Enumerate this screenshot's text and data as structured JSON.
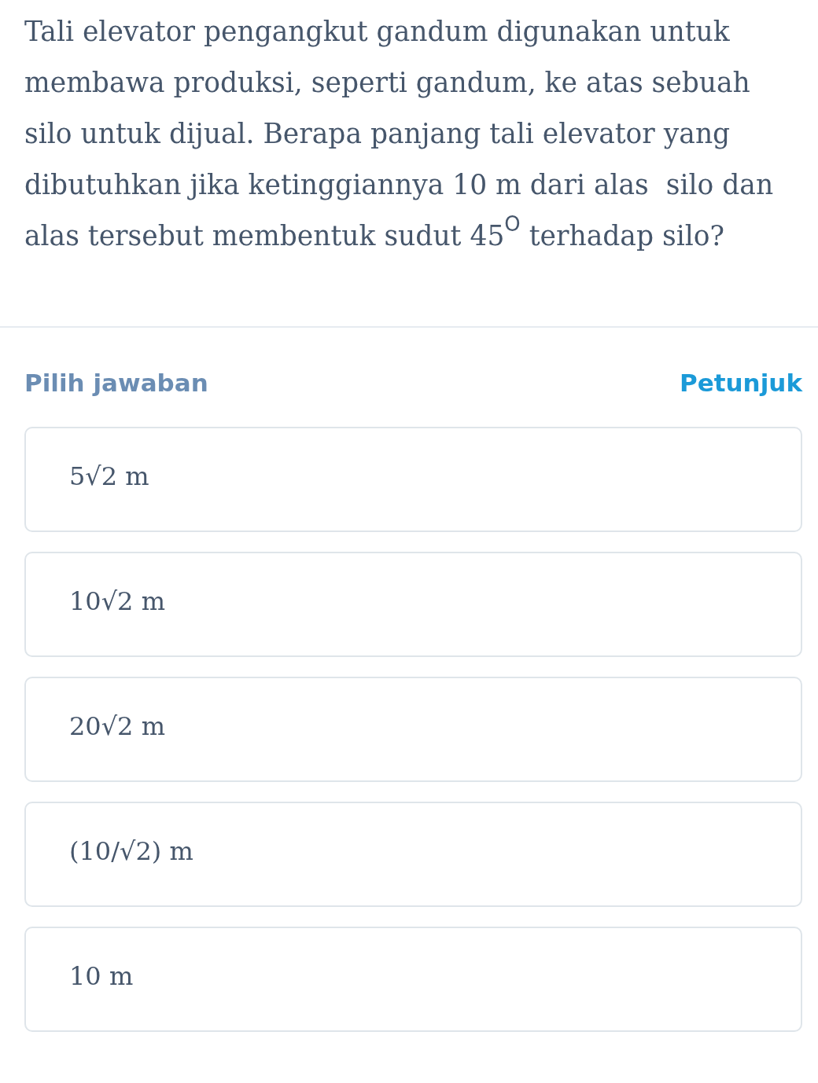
{
  "question": {
    "text": "Tali elevator pengangkut gandum digunakan untuk membawa produksi, seperti gandum, ke atas sebuah silo untuk dijual. Berapa panjang tali elevator yang dibutuhkan jika ketinggiannya 10 m dari alas  silo dan alas tersebut membentuk sudut 45$^{O}$ terhadap silo?"
  },
  "answers": {
    "heading": "Pilih jawaban",
    "hint_link": "Petunjuk",
    "options": [
      {
        "label": "5√2 m",
        "selected": false
      },
      {
        "label": "10√2 m",
        "selected": false
      },
      {
        "label": "20√2 m",
        "selected": false
      },
      {
        "label": "(10/√2) m",
        "selected": false
      },
      {
        "label": "10 m",
        "selected": false
      }
    ]
  }
}
